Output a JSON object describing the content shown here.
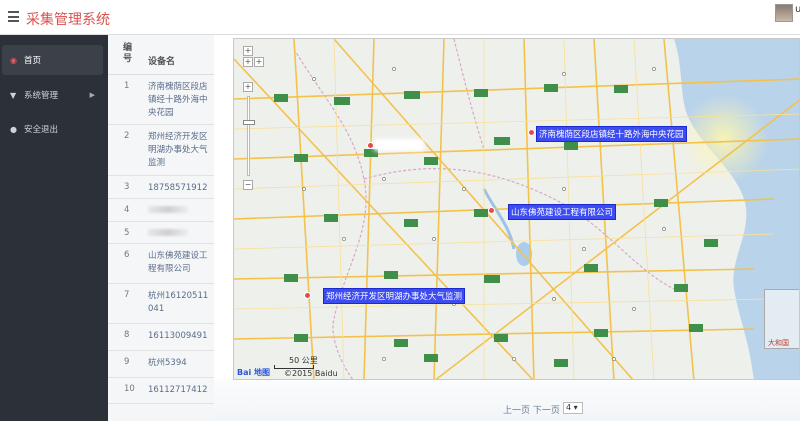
{
  "app": {
    "title": "采集管理系统",
    "username": "u"
  },
  "sidebar": {
    "items": [
      {
        "label": "首页",
        "icon": "home-icon",
        "active": true
      },
      {
        "label": "系统管理",
        "icon": "filter-icon",
        "has_submenu": true
      },
      {
        "label": "安全退出",
        "icon": "user-icon"
      }
    ]
  },
  "table": {
    "headers": {
      "no": "编号",
      "name": "设备名"
    },
    "rows": [
      {
        "no": "1",
        "name": "济南槐荫区段店镇经十路外海中央花园"
      },
      {
        "no": "2",
        "name": "郑州经济开发区明湖办事处大气监测"
      },
      {
        "no": "3",
        "name": "18758571912"
      },
      {
        "no": "4",
        "name": ""
      },
      {
        "no": "5",
        "name": ""
      },
      {
        "no": "6",
        "name": "山东佛苑建设工程有限公司"
      },
      {
        "no": "7",
        "name": "杭州16120511041"
      },
      {
        "no": "8",
        "name": "16113009491"
      },
      {
        "no": "9",
        "name": "杭州5394"
      },
      {
        "no": "10",
        "name": "16112717412"
      }
    ]
  },
  "map": {
    "markers": [
      {
        "label": "济南槐荫区段店镇经十路外海中央花园"
      },
      {
        "label": "山东佛苑建设工程有限公司"
      },
      {
        "label": "郑州经济开发区明湖办事处大气监测"
      }
    ],
    "scale": "50 公里",
    "copyright": "©2015 Baidu",
    "logo": "Bai 地图",
    "inset_label": "大和国"
  },
  "pagination": {
    "prev": "上一页",
    "next": "下一页",
    "page": "4"
  },
  "colors": {
    "sidebar_bg": "#2c3139",
    "accent": "#d9534f",
    "marker_label_bg": "#3d4cf0"
  }
}
